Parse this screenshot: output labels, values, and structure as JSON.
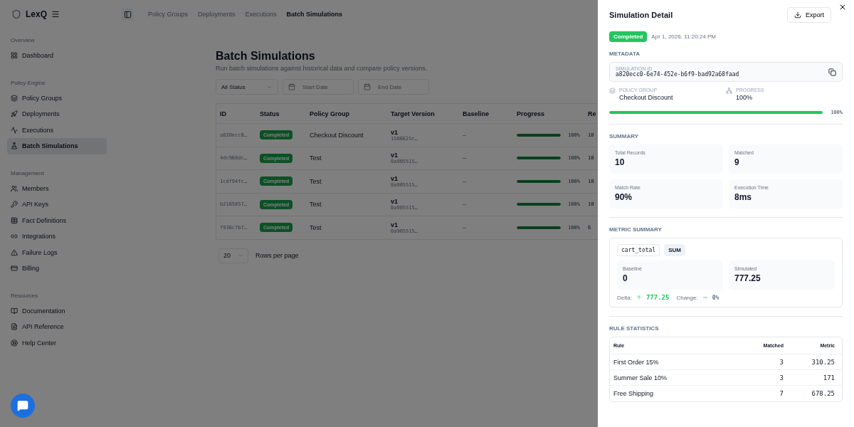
{
  "app": {
    "name": "LexQ"
  },
  "top_nav": [
    {
      "label": "Policy Groups",
      "selected": false
    },
    {
      "label": "Deployments",
      "selected": false
    },
    {
      "label": "Executions",
      "selected": false
    },
    {
      "label": "Batch Simulations",
      "selected": true
    }
  ],
  "sidebar": {
    "sections": [
      {
        "title": "Overview",
        "items": [
          {
            "label": "Dashboard",
            "kind": "grid",
            "selected": false
          }
        ]
      },
      {
        "title": "Policy Engine",
        "items": [
          {
            "label": "Policy Groups",
            "kind": "layers",
            "selected": false
          },
          {
            "label": "Deployments",
            "kind": "rocket",
            "selected": false
          },
          {
            "label": "Executions",
            "kind": "activity",
            "selected": false
          },
          {
            "label": "Batch Simulations",
            "kind": "flask",
            "selected": true
          }
        ]
      },
      {
        "title": "Management",
        "items": [
          {
            "label": "Members",
            "kind": "users",
            "selected": false
          },
          {
            "label": "API Keys",
            "kind": "key",
            "selected": false
          },
          {
            "label": "Fact Definitions",
            "kind": "table",
            "selected": false
          },
          {
            "label": "Integrations",
            "kind": "link",
            "selected": false
          },
          {
            "label": "Failure Logs",
            "kind": "warning",
            "selected": false
          },
          {
            "label": "Billing",
            "kind": "card",
            "selected": false
          }
        ]
      },
      {
        "title": "Resources",
        "items": [
          {
            "label": "Documentation",
            "kind": "book",
            "selected": false
          },
          {
            "label": "API Reference",
            "kind": "file",
            "selected": false
          },
          {
            "label": "Help Center",
            "kind": "help",
            "selected": false
          }
        ]
      }
    ]
  },
  "page": {
    "title": "Batch Simulations",
    "subtitle": "Run batch simulations against historical data and compare policy versions."
  },
  "filters": {
    "status": "All Status",
    "start_placeholder": "Start Date",
    "end_placeholder": "End Date"
  },
  "table": {
    "columns": [
      "ID",
      "Status",
      "Policy Group",
      "Target Version",
      "Baseline",
      "Progress",
      "Re"
    ],
    "rows": [
      {
        "id": "a820ecc0…",
        "status": "Completed",
        "policy_group": "Checkout Discount",
        "version": "v1",
        "hash": "1586625c…",
        "baseline": "–",
        "level": 1,
        "progress": "100%",
        "column_7": "10"
      },
      {
        "id": "4dc968dc…",
        "status": "Completed",
        "policy_group": "Test",
        "version": "v1",
        "hash": "0a905515…",
        "baseline": "–",
        "level": 1,
        "progress": "100%",
        "column_7": "10"
      },
      {
        "id": "1cdf94fc…",
        "status": "Completed",
        "policy_group": "Test",
        "version": "v1",
        "hash": "0a905515…",
        "baseline": "–",
        "level": 1,
        "progress": "100%",
        "column_7": "10"
      },
      {
        "id": "b2165857…",
        "status": "Completed",
        "policy_group": "Test",
        "version": "v1",
        "hash": "0a905515…",
        "baseline": "–",
        "level": 1,
        "progress": "100%",
        "column_7": "10"
      },
      {
        "id": "f936c7b7…",
        "status": "Completed",
        "policy_group": "Test",
        "version": "v1",
        "hash": "0a905515…",
        "baseline": "–",
        "level": 1,
        "progress": "100%",
        "column_7": "6"
      }
    ]
  },
  "pagination": {
    "rows_per_page": "20",
    "label": "Rows per page"
  },
  "drawer": {
    "title": "Simulation Detail",
    "export_label": "Export",
    "status": "Completed",
    "timestamp": "Apr 1, 2026, 11:20:24 PM",
    "metadata": {
      "heading": "METADATA",
      "id_label": "SIMULATION ID",
      "id": "a820ecc0-6e74-452e-b6f9-bad92a68faad",
      "group_label": "POLICY GROUP",
      "group": "Checkout Discount",
      "progress_label": "PROGRESS",
      "progress": "100%",
      "level": 1,
      "bar_reading": "100%"
    },
    "summary": {
      "heading": "SUMMARY",
      "stats": [
        {
          "label": "Total Records",
          "value": "10"
        },
        {
          "label": "Matched",
          "value": "9"
        },
        {
          "label": "Match Rate",
          "value": "90%"
        },
        {
          "label": "Execution Time",
          "value": "8ms"
        }
      ]
    },
    "metric_summary": {
      "heading": "METRIC SUMMARY",
      "metric": "cart_total",
      "aggregation": "SUM",
      "baseline_label": "Baseline",
      "baseline": "0",
      "simulated_label": "Simulated",
      "simulated": "777.25",
      "delta_label": "Delta:",
      "delta": "777.25",
      "change_label": "Change:",
      "change": "0%"
    },
    "rule_statistics": {
      "heading": "RULE STATISTICS",
      "columns": [
        "Rule",
        "Matched",
        "Metric"
      ],
      "rows": [
        {
          "rule": "First Order 15%",
          "matched": "3",
          "metric": "310.25"
        },
        {
          "rule": "Summer Sale 10%",
          "matched": "3",
          "metric": "171"
        },
        {
          "rule": "Free Shipping",
          "matched": "7",
          "metric": "678.25"
        }
      ]
    }
  }
}
